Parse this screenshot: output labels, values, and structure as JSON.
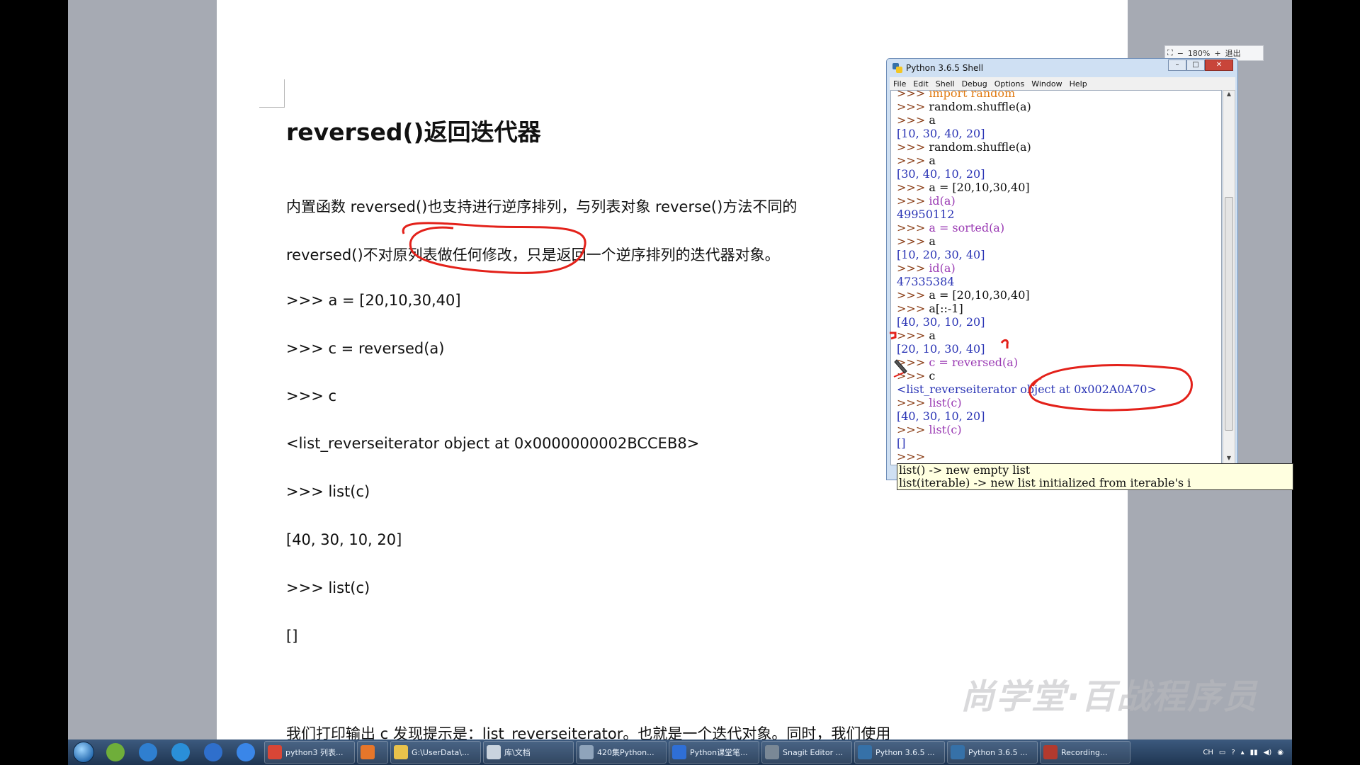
{
  "document": {
    "title": "reversed()返回迭代器",
    "lines": [
      "内置函数 reversed()也支持进行逆序排列，与列表对象 reverse()方法不同的",
      "reversed()不对原列表做任何修改，只是返回一个逆序排列的迭代器对象。",
      ">>> a = [20,10,30,40]",
      ">>> c = reversed(a)",
      ">>> c",
      "<list_reverseiterator object at 0x0000000002BCCEB8>",
      ">>> list(c)",
      "[40, 30, 10, 20]",
      ">>> list(c)",
      "[]",
      "我们打印输出 c 发现提示是：list_reverseiterator。也就是一个迭代对象。同时，我们使用"
    ]
  },
  "zoom": {
    "fit_icon": "fit-screen-icon",
    "minus": "−",
    "level": "180%",
    "plus": "+",
    "exit": "退出"
  },
  "shell": {
    "title": "Python 3.6.5 Shell",
    "menu": [
      "File",
      "Edit",
      "Shell",
      "Debug",
      "Options",
      "Window",
      "Help"
    ],
    "lines": [
      {
        "prompt": ">>> ",
        "code": "import random",
        "kind": "kw"
      },
      {
        "prompt": ">>> ",
        "code": "random.shuffle(a)",
        "kind": "code"
      },
      {
        "prompt": ">>> ",
        "code": "a",
        "kind": "code"
      },
      {
        "prompt": "",
        "code": "[10, 30, 40, 20]",
        "kind": "out"
      },
      {
        "prompt": ">>> ",
        "code": "random.shuffle(a)",
        "kind": "code"
      },
      {
        "prompt": ">>> ",
        "code": "a",
        "kind": "code"
      },
      {
        "prompt": "",
        "code": "[30, 40, 10, 20]",
        "kind": "out"
      },
      {
        "prompt": ">>> ",
        "code": "a = [20,10,30,40]",
        "kind": "code"
      },
      {
        "prompt": ">>> ",
        "code": "id(a)",
        "kind": "fn"
      },
      {
        "prompt": "",
        "code": "49950112",
        "kind": "out"
      },
      {
        "prompt": ">>> ",
        "code": "a = sorted(a)",
        "kind": "fn"
      },
      {
        "prompt": ">>> ",
        "code": "a",
        "kind": "code"
      },
      {
        "prompt": "",
        "code": "[10, 20, 30, 40]",
        "kind": "out"
      },
      {
        "prompt": ">>> ",
        "code": "id(a)",
        "kind": "fn"
      },
      {
        "prompt": "",
        "code": "47335384",
        "kind": "out"
      },
      {
        "prompt": ">>> ",
        "code": "a = [20,10,30,40]",
        "kind": "code"
      },
      {
        "prompt": ">>> ",
        "code": "a[::-1]",
        "kind": "code"
      },
      {
        "prompt": "",
        "code": "[40, 30, 10, 20]",
        "kind": "out"
      },
      {
        "prompt": ">>> ",
        "code": "a",
        "kind": "code"
      },
      {
        "prompt": "",
        "code": "[20, 10, 30, 40]",
        "kind": "out"
      },
      {
        "prompt": ">>> ",
        "code": "c = reversed(a)",
        "kind": "fn"
      },
      {
        "prompt": ">>> ",
        "code": "c",
        "kind": "code"
      },
      {
        "prompt": "",
        "code": "<list_reverseiterator object at 0x002A0A70>",
        "kind": "out"
      },
      {
        "prompt": ">>> ",
        "code": "list(c)",
        "kind": "fn"
      },
      {
        "prompt": "",
        "code": "[40, 30, 10, 20]",
        "kind": "out"
      },
      {
        "prompt": ">>> ",
        "code": "list(c)",
        "kind": "fn"
      },
      {
        "prompt": "",
        "code": "[]",
        "kind": "out"
      },
      {
        "prompt": ">>> ",
        "code": "",
        "kind": "code"
      }
    ],
    "calltip": [
      "list() -> new empty list",
      "list(iterable) -> new list initialized from iterable's i"
    ]
  },
  "watermark": "尚学堂·百战程序员",
  "taskbar": {
    "pinned": [
      {
        "name": "pinned-app-1-icon",
        "color": "#6fae3a"
      },
      {
        "name": "ie-browser-icon",
        "color": "#2f7fd0"
      },
      {
        "name": "k-app-icon",
        "color": "#2a8fd8"
      },
      {
        "name": "baidu-cloud-icon",
        "color": "#2f6fcc"
      },
      {
        "name": "pen-app-icon",
        "color": "#3a86e8"
      }
    ],
    "tasks": [
      {
        "label": "python3 列表...",
        "icon": "chrome-icon",
        "color": "#d94636"
      },
      {
        "label": "",
        "icon": "firefox-icon",
        "color": "#e6762a"
      },
      {
        "label": "G:\\UserData\\...",
        "icon": "folder-icon",
        "color": "#e9c24b"
      },
      {
        "label": "库\\文档",
        "icon": "library-icon",
        "color": "#c9d3de"
      },
      {
        "label": "420集Python...",
        "icon": "video-icon",
        "color": "#8fa4bb"
      },
      {
        "label": "Python课堂笔...",
        "icon": "wps-writer-icon",
        "color": "#2f6fd6"
      },
      {
        "label": "Snagit Editor ...",
        "icon": "snagit-icon",
        "color": "#7a8896"
      },
      {
        "label": "Python 3.6.5 ...",
        "icon": "python-icon",
        "color": "#3671a8"
      },
      {
        "label": "Python 3.6.5 ...",
        "icon": "python-icon",
        "color": "#3671a8"
      },
      {
        "label": "Recording...",
        "icon": "recording-icon",
        "color": "#b33a2e"
      }
    ],
    "tray": [
      "CH",
      "▭",
      "?",
      "▴",
      "▮▮",
      "◀)",
      "◉"
    ]
  },
  "colors": {
    "desk": "#a6aab3",
    "annotation": "#e3211a",
    "prompt": "#8a3d16",
    "output": "#2a34b5",
    "keyword": "#e07a12",
    "builtin": "#9a3ab3"
  }
}
